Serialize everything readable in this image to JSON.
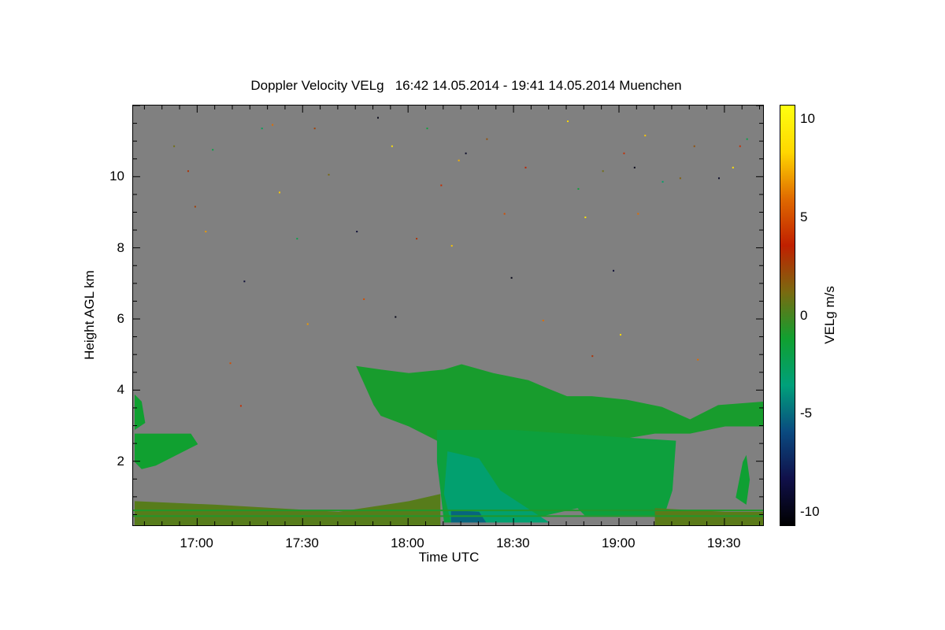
{
  "chart_data": {
    "type": "heatmap",
    "title": "Doppler Velocity VELg   16:42 14.05.2014 - 19:41 14.05.2014 Muenchen",
    "xlabel": "Time UTC",
    "ylabel": "Height AGL km",
    "colorbar_label": "VELg m/s",
    "xlim": [
      "16:42",
      "19:41"
    ],
    "ylim": [
      0.2,
      12.0
    ],
    "x_ticks": [
      "17:00",
      "17:30",
      "18:00",
      "18:30",
      "19:00",
      "19:30"
    ],
    "y_ticks": [
      "2",
      "4",
      "6",
      "8",
      "10"
    ],
    "colorbar_ticks": [
      "10",
      "5",
      "0",
      "-5",
      "-10"
    ],
    "colorbar_range": [
      -10.7,
      10.7
    ],
    "background_color": "#808080",
    "colormap": [
      "#000000",
      "#10104a",
      "#0a4a80",
      "#00a07a",
      "#10a030",
      "#7a6a10",
      "#c02000",
      "#e06a00",
      "#ffd700",
      "#ffff10"
    ],
    "echo_regions": [
      {
        "name": "low-cloud-left",
        "velocity": -1.2,
        "boundary": [
          [
            "16:42",
            2.0
          ],
          [
            "16:42",
            3.9
          ],
          [
            "16:44",
            3.7
          ],
          [
            "16:45",
            3.1
          ],
          [
            "16:42",
            2.9
          ],
          [
            "16:42",
            2.8
          ],
          [
            "16:58",
            2.8
          ],
          [
            "17:00",
            2.5
          ],
          [
            "16:56",
            2.3
          ],
          [
            "16:52",
            2.1
          ],
          [
            "16:48",
            1.9
          ],
          [
            "16:44",
            1.8
          ]
        ]
      },
      {
        "name": "main-cloud-upper",
        "velocity": -1.0,
        "boundary": [
          [
            "17:45",
            4.7
          ],
          [
            "17:52",
            4.6
          ],
          [
            "18:00",
            4.5
          ],
          [
            "18:10",
            4.6
          ],
          [
            "18:15",
            4.75
          ],
          [
            "18:24",
            4.5
          ],
          [
            "18:34",
            4.3
          ],
          [
            "18:40",
            4.05
          ],
          [
            "18:45",
            3.85
          ],
          [
            "18:52",
            3.85
          ],
          [
            "19:02",
            3.75
          ],
          [
            "19:12",
            3.55
          ],
          [
            "19:20",
            3.2
          ],
          [
            "19:28",
            3.6
          ],
          [
            "19:41",
            3.7
          ],
          [
            "19:41",
            3.0
          ],
          [
            "19:30",
            3.0
          ],
          [
            "19:20",
            2.8
          ],
          [
            "19:10",
            2.8
          ],
          [
            "18:58",
            2.6
          ],
          [
            "18:30",
            2.5
          ],
          [
            "18:10",
            2.5
          ],
          [
            "18:00",
            3.0
          ],
          [
            "17:52",
            3.3
          ],
          [
            "17:50",
            3.6
          ]
        ]
      },
      {
        "name": "main-cloud-lower",
        "velocity": -1.6,
        "boundary": [
          [
            "18:08",
            2.9
          ],
          [
            "18:30",
            2.9
          ],
          [
            "19:00",
            2.7
          ],
          [
            "19:16",
            2.6
          ],
          [
            "19:15",
            1.2
          ],
          [
            "19:13",
            0.6
          ],
          [
            "19:10",
            0.5
          ],
          [
            "18:50",
            0.5
          ],
          [
            "18:48",
            0.7
          ],
          [
            "18:30",
            0.3
          ],
          [
            "18:10",
            0.3
          ],
          [
            "18:09",
            1.2
          ],
          [
            "18:08",
            2.0
          ]
        ]
      },
      {
        "name": "downdraft-core",
        "velocity": -3.2,
        "boundary": [
          [
            "18:11",
            2.3
          ],
          [
            "18:20",
            2.1
          ],
          [
            "18:26",
            1.2
          ],
          [
            "18:40",
            0.3
          ],
          [
            "18:12",
            0.3
          ],
          [
            "18:10",
            1.1
          ]
        ]
      },
      {
        "name": "strong-downdraft-base",
        "velocity": -5.2,
        "boundary": [
          [
            "18:12",
            0.65
          ],
          [
            "18:20",
            0.6
          ],
          [
            "18:22",
            0.3
          ],
          [
            "18:12",
            0.3
          ]
        ]
      },
      {
        "name": "fragments-right",
        "velocity": -1.3,
        "boundary": [
          [
            "19:33",
            1.0
          ],
          [
            "19:35",
            2.0
          ],
          [
            "19:36",
            2.2
          ],
          [
            "19:37",
            1.5
          ],
          [
            "19:36",
            0.8
          ]
        ]
      },
      {
        "name": "boundary-layer",
        "velocity": 0.4,
        "boundary": [
          [
            "16:42",
            0.2
          ],
          [
            "16:42",
            0.9
          ],
          [
            "17:05",
            0.8
          ],
          [
            "17:40",
            0.6
          ],
          [
            "18:00",
            0.9
          ],
          [
            "18:09",
            1.1
          ],
          [
            "18:09",
            0.2
          ]
        ]
      },
      {
        "name": "boundary-layer-right",
        "velocity": 0.5,
        "boundary": [
          [
            "19:10",
            0.2
          ],
          [
            "19:10",
            0.7
          ],
          [
            "19:30",
            0.6
          ],
          [
            "19:41",
            0.6
          ],
          [
            "19:41",
            0.2
          ]
        ]
      }
    ],
    "horizontal_lines": [
      {
        "height": 0.48,
        "velocity": -0.8
      },
      {
        "height": 0.64,
        "velocity": -0.8
      }
    ],
    "noise_pixels": [
      [
        "16:53",
        10.9,
        1.0
      ],
      [
        "16:57",
        10.2,
        3.0
      ],
      [
        "16:59",
        9.2,
        2.5
      ],
      [
        "17:02",
        8.5,
        7.0
      ],
      [
        "17:04",
        10.8,
        -2.0
      ],
      [
        "17:13",
        7.1,
        -9.0
      ],
      [
        "17:18",
        11.4,
        -2.5
      ],
      [
        "17:21",
        11.5,
        6.0
      ],
      [
        "17:23",
        9.6,
        8.0
      ],
      [
        "17:28",
        8.3,
        -2.0
      ],
      [
        "17:33",
        11.4,
        2.5
      ],
      [
        "17:37",
        10.1,
        1.2
      ],
      [
        "17:45",
        8.5,
        -9.0
      ],
      [
        "17:51",
        11.7,
        -10.0
      ],
      [
        "17:55",
        10.9,
        9.0
      ],
      [
        "18:02",
        8.3,
        3.0
      ],
      [
        "18:05",
        11.4,
        -1.5
      ],
      [
        "18:09",
        9.8,
        4.0
      ],
      [
        "18:12",
        8.1,
        8.0
      ],
      [
        "18:14",
        10.5,
        7.5
      ],
      [
        "18:16",
        10.7,
        -9.5
      ],
      [
        "18:22",
        11.1,
        2.0
      ],
      [
        "18:27",
        9.0,
        5.0
      ],
      [
        "18:29",
        7.2,
        -10.0
      ],
      [
        "18:33",
        10.3,
        3.5
      ],
      [
        "18:38",
        6.0,
        6.0
      ],
      [
        "18:45",
        11.6,
        8.5
      ],
      [
        "18:48",
        9.7,
        -1.5
      ],
      [
        "18:50",
        8.9,
        9.0
      ],
      [
        "18:55",
        10.2,
        1.0
      ],
      [
        "18:58",
        7.4,
        -9.0
      ],
      [
        "19:01",
        10.7,
        4.0
      ],
      [
        "19:04",
        10.3,
        -10.0
      ],
      [
        "19:05",
        9.0,
        6.0
      ],
      [
        "19:07",
        11.2,
        8.0
      ],
      [
        "19:12",
        9.9,
        -3.0
      ],
      [
        "19:17",
        10.0,
        1.5
      ],
      [
        "19:21",
        10.9,
        2.0
      ],
      [
        "19:28",
        10.0,
        -9.5
      ],
      [
        "19:32",
        10.3,
        9.0
      ],
      [
        "19:34",
        10.9,
        4.0
      ],
      [
        "19:36",
        11.1,
        -2.0
      ],
      [
        "17:56",
        6.1,
        -10.0
      ],
      [
        "17:47",
        6.6,
        5.0
      ],
      [
        "17:31",
        5.9,
        7.0
      ],
      [
        "19:22",
        4.9,
        6.0
      ],
      [
        "19:00",
        5.6,
        8.5
      ],
      [
        "17:09",
        4.8,
        5.0
      ],
      [
        "18:52",
        5.0,
        3.0
      ],
      [
        "17:12",
        3.6,
        4.0
      ]
    ]
  }
}
